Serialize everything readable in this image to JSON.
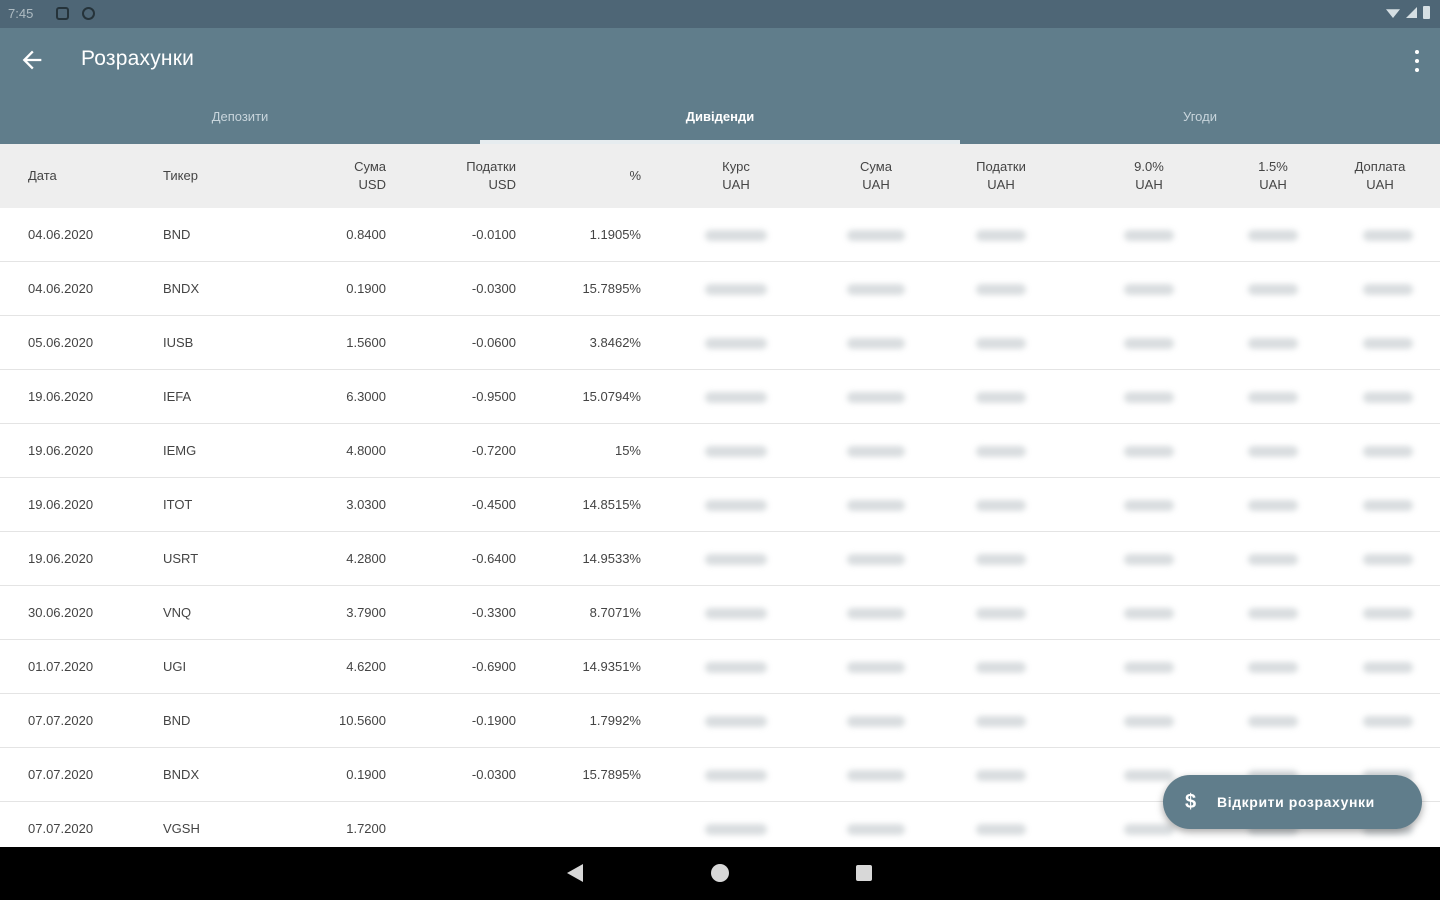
{
  "status_bar": {
    "time": "7:45"
  },
  "app_bar": {
    "title": "Розрахунки"
  },
  "tabs": [
    {
      "label": "Депозити",
      "active": false
    },
    {
      "label": "Дивіденди",
      "active": true
    },
    {
      "label": "Угоди",
      "active": false
    }
  ],
  "table": {
    "headers": [
      [
        "Дата"
      ],
      [
        "Тикер"
      ],
      [
        "Сума",
        "USD"
      ],
      [
        "Податки",
        "USD"
      ],
      [
        "%"
      ],
      [
        "Курс",
        "UAH"
      ],
      [
        "Сума",
        "UAH"
      ],
      [
        "Податки",
        "UAH"
      ],
      [
        "9.0%",
        "UAH"
      ],
      [
        "1.5%",
        "UAH"
      ],
      [
        "Доплата",
        "UAH"
      ]
    ],
    "rows": [
      {
        "date": "04.06.2020",
        "ticker": "BND",
        "sum_usd": "0.8400",
        "tax_usd": "-0.0100",
        "pct": "1.1905%"
      },
      {
        "date": "04.06.2020",
        "ticker": "BNDX",
        "sum_usd": "0.1900",
        "tax_usd": "-0.0300",
        "pct": "15.7895%"
      },
      {
        "date": "05.06.2020",
        "ticker": "IUSB",
        "sum_usd": "1.5600",
        "tax_usd": "-0.0600",
        "pct": "3.8462%"
      },
      {
        "date": "19.06.2020",
        "ticker": "IEFA",
        "sum_usd": "6.3000",
        "tax_usd": "-0.9500",
        "pct": "15.0794%"
      },
      {
        "date": "19.06.2020",
        "ticker": "IEMG",
        "sum_usd": "4.8000",
        "tax_usd": "-0.7200",
        "pct": "15%"
      },
      {
        "date": "19.06.2020",
        "ticker": "ITOT",
        "sum_usd": "3.0300",
        "tax_usd": "-0.4500",
        "pct": "14.8515%"
      },
      {
        "date": "19.06.2020",
        "ticker": "USRT",
        "sum_usd": "4.2800",
        "tax_usd": "-0.6400",
        "pct": "14.9533%"
      },
      {
        "date": "30.06.2020",
        "ticker": "VNQ",
        "sum_usd": "3.7900",
        "tax_usd": "-0.3300",
        "pct": "8.7071%"
      },
      {
        "date": "01.07.2020",
        "ticker": "UGI",
        "sum_usd": "4.6200",
        "tax_usd": "-0.6900",
        "pct": "14.9351%"
      },
      {
        "date": "07.07.2020",
        "ticker": "BND",
        "sum_usd": "10.5600",
        "tax_usd": "-0.1900",
        "pct": "1.7992%"
      },
      {
        "date": "07.07.2020",
        "ticker": "BNDX",
        "sum_usd": "0.1900",
        "tax_usd": "-0.0300",
        "pct": "15.7895%"
      },
      {
        "date": "07.07.2020",
        "ticker": "VGSH",
        "sum_usd": "1.7200",
        "tax_usd": "",
        "pct": ""
      }
    ]
  },
  "fab": {
    "icon": "dollar-icon",
    "label": "Відкрити розрахунки"
  },
  "colors": {
    "primary": "#607d8b",
    "status_bar": "#4e6676",
    "header_bg": "#eeeeee"
  }
}
